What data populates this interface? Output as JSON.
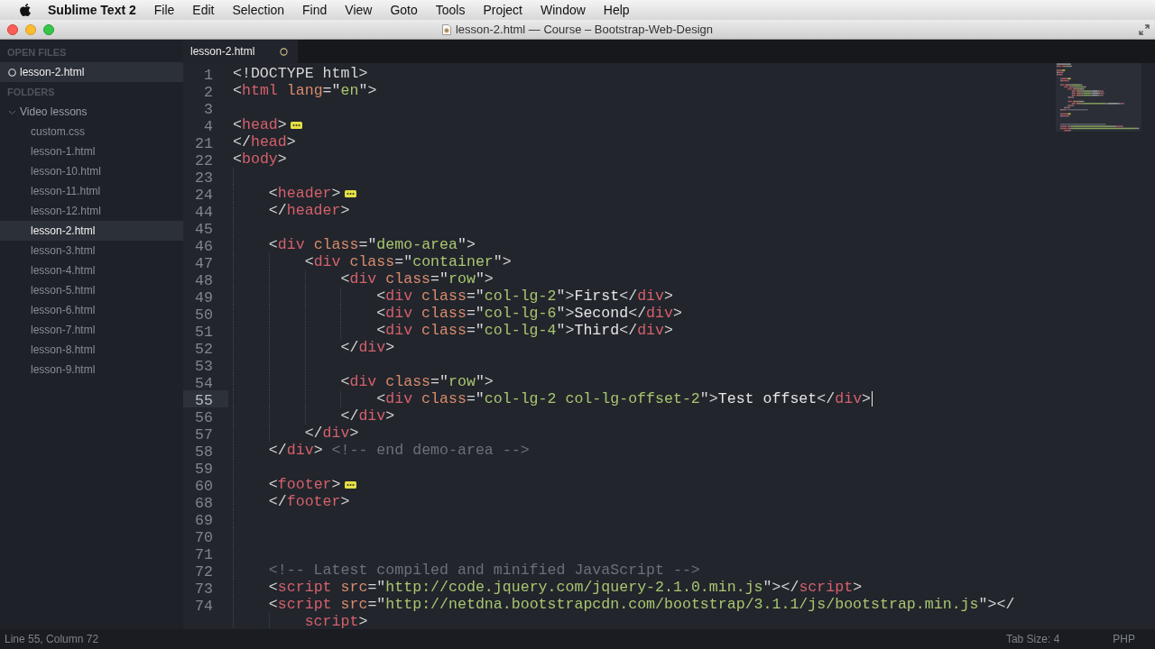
{
  "menu_bar": {
    "app_name": "Sublime Text 2",
    "items": [
      "File",
      "Edit",
      "Selection",
      "Find",
      "View",
      "Goto",
      "Tools",
      "Project",
      "Window",
      "Help"
    ]
  },
  "window": {
    "title": "lesson-2.html — Course – Bootstrap-Web-Design"
  },
  "sidebar": {
    "open_files_heading": "OPEN FILES",
    "open_files": [
      {
        "name": "lesson-2.html",
        "selected": true,
        "modified": true
      }
    ],
    "folders_heading": "FOLDERS",
    "folders": [
      {
        "name": "Video lessons",
        "expanded": true,
        "children": [
          {
            "name": "custom.css",
            "selected": false
          },
          {
            "name": "lesson-1.html",
            "selected": false
          },
          {
            "name": "lesson-10.html",
            "selected": false
          },
          {
            "name": "lesson-11.html",
            "selected": false
          },
          {
            "name": "lesson-12.html",
            "selected": false
          },
          {
            "name": "lesson-2.html",
            "selected": true
          },
          {
            "name": "lesson-3.html",
            "selected": false
          },
          {
            "name": "lesson-4.html",
            "selected": false
          },
          {
            "name": "lesson-5.html",
            "selected": false
          },
          {
            "name": "lesson-6.html",
            "selected": false
          },
          {
            "name": "lesson-7.html",
            "selected": false
          },
          {
            "name": "lesson-8.html",
            "selected": false
          },
          {
            "name": "lesson-9.html",
            "selected": false
          }
        ]
      }
    ]
  },
  "tabs": [
    {
      "label": "lesson-2.html",
      "selected": true,
      "modified": true
    }
  ],
  "editor": {
    "lines": [
      {
        "number": "1",
        "current": false,
        "tokens": [
          {
            "kind": "punct",
            "text": "<!DOCTYPE html>"
          }
        ]
      },
      {
        "number": "2",
        "current": false,
        "tokens": [
          {
            "kind": "punct",
            "text": "<"
          },
          {
            "kind": "tag",
            "text": "html"
          },
          {
            "kind": "attr",
            "text": " lang"
          },
          {
            "kind": "punct",
            "text": "=\""
          },
          {
            "kind": "string",
            "text": "en"
          },
          {
            "kind": "punct",
            "text": "\">"
          }
        ]
      },
      {
        "number": "3",
        "current": false
      },
      {
        "number": "4",
        "current": false,
        "tokens": [
          {
            "kind": "punct",
            "text": "<"
          },
          {
            "kind": "tag",
            "text": "head"
          },
          {
            "kind": "punct",
            "text": ">"
          },
          {
            "kind": "fold"
          }
        ]
      },
      {
        "number": "21",
        "current": false,
        "tokens": [
          {
            "kind": "punct",
            "text": "</"
          },
          {
            "kind": "tag",
            "text": "head"
          },
          {
            "kind": "punct",
            "text": ">"
          }
        ]
      },
      {
        "number": "22",
        "current": false,
        "tokens": [
          {
            "kind": "punct",
            "text": "<"
          },
          {
            "kind": "tag",
            "text": "body"
          },
          {
            "kind": "punct",
            "text": ">"
          }
        ]
      },
      {
        "number": "23",
        "current": false
      },
      {
        "number": "24",
        "current": false,
        "tokens": [
          {
            "kind": "punct",
            "text": "    <"
          },
          {
            "kind": "tag",
            "text": "header"
          },
          {
            "kind": "punct",
            "text": ">"
          },
          {
            "kind": "fold"
          }
        ]
      },
      {
        "number": "44",
        "current": false,
        "tokens": [
          {
            "kind": "punct",
            "text": "    </"
          },
          {
            "kind": "tag",
            "text": "header"
          },
          {
            "kind": "punct",
            "text": ">"
          }
        ]
      },
      {
        "number": "45",
        "current": false
      },
      {
        "number": "46",
        "current": false,
        "tokens": [
          {
            "kind": "punct",
            "text": "    <"
          },
          {
            "kind": "tag",
            "text": "div"
          },
          {
            "kind": "attr",
            "text": " class"
          },
          {
            "kind": "punct",
            "text": "=\""
          },
          {
            "kind": "string",
            "text": "demo-area"
          },
          {
            "kind": "punct",
            "text": "\">"
          }
        ]
      },
      {
        "number": "47",
        "current": false,
        "tokens": [
          {
            "kind": "punct",
            "text": "        <"
          },
          {
            "kind": "tag",
            "text": "div"
          },
          {
            "kind": "attr",
            "text": " class"
          },
          {
            "kind": "punct",
            "text": "=\""
          },
          {
            "kind": "string",
            "text": "container"
          },
          {
            "kind": "punct",
            "text": "\">"
          }
        ]
      },
      {
        "number": "48",
        "current": false,
        "tokens": [
          {
            "kind": "punct",
            "text": "            <"
          },
          {
            "kind": "tag",
            "text": "div"
          },
          {
            "kind": "attr",
            "text": " class"
          },
          {
            "kind": "punct",
            "text": "=\""
          },
          {
            "kind": "string",
            "text": "row"
          },
          {
            "kind": "punct",
            "text": "\">"
          }
        ]
      },
      {
        "number": "49",
        "current": false,
        "tokens": [
          {
            "kind": "punct",
            "text": "                <"
          },
          {
            "kind": "tag",
            "text": "div"
          },
          {
            "kind": "attr",
            "text": " class"
          },
          {
            "kind": "punct",
            "text": "=\""
          },
          {
            "kind": "string",
            "text": "col-lg-2"
          },
          {
            "kind": "punct",
            "text": "\">"
          },
          {
            "kind": "text",
            "text": "First"
          },
          {
            "kind": "punct",
            "text": "</"
          },
          {
            "kind": "tag",
            "text": "div"
          },
          {
            "kind": "punct",
            "text": ">"
          }
        ]
      },
      {
        "number": "50",
        "current": false,
        "tokens": [
          {
            "kind": "punct",
            "text": "                <"
          },
          {
            "kind": "tag",
            "text": "div"
          },
          {
            "kind": "attr",
            "text": " class"
          },
          {
            "kind": "punct",
            "text": "=\""
          },
          {
            "kind": "string",
            "text": "col-lg-6"
          },
          {
            "kind": "punct",
            "text": "\">"
          },
          {
            "kind": "text",
            "text": "Second"
          },
          {
            "kind": "punct",
            "text": "</"
          },
          {
            "kind": "tag",
            "text": "div"
          },
          {
            "kind": "punct",
            "text": ">"
          }
        ]
      },
      {
        "number": "51",
        "current": false,
        "tokens": [
          {
            "kind": "punct",
            "text": "                <"
          },
          {
            "kind": "tag",
            "text": "div"
          },
          {
            "kind": "attr",
            "text": " class"
          },
          {
            "kind": "punct",
            "text": "=\""
          },
          {
            "kind": "string",
            "text": "col-lg-4"
          },
          {
            "kind": "punct",
            "text": "\">"
          },
          {
            "kind": "text",
            "text": "Third"
          },
          {
            "kind": "punct",
            "text": "</"
          },
          {
            "kind": "tag",
            "text": "div"
          },
          {
            "kind": "punct",
            "text": ">"
          }
        ]
      },
      {
        "number": "52",
        "current": false,
        "tokens": [
          {
            "kind": "punct",
            "text": "            </"
          },
          {
            "kind": "tag",
            "text": "div"
          },
          {
            "kind": "punct",
            "text": ">"
          }
        ]
      },
      {
        "number": "53",
        "current": false
      },
      {
        "number": "54",
        "current": false,
        "tokens": [
          {
            "kind": "punct",
            "text": "            <"
          },
          {
            "kind": "tag",
            "text": "div"
          },
          {
            "kind": "attr",
            "text": " class"
          },
          {
            "kind": "punct",
            "text": "=\""
          },
          {
            "kind": "string",
            "text": "row"
          },
          {
            "kind": "punct",
            "text": "\">"
          }
        ]
      },
      {
        "number": "55",
        "current": true,
        "tokens": [
          {
            "kind": "punct",
            "text": "                <"
          },
          {
            "kind": "tag",
            "text": "div"
          },
          {
            "kind": "attr",
            "text": " class"
          },
          {
            "kind": "punct",
            "text": "=\""
          },
          {
            "kind": "string",
            "text": "col-lg-2 col-lg-offset-2"
          },
          {
            "kind": "punct",
            "text": "\">"
          },
          {
            "kind": "text",
            "text": "Test offset"
          },
          {
            "kind": "punct",
            "text": "</"
          },
          {
            "kind": "tag",
            "text": "div"
          },
          {
            "kind": "punct",
            "text": ">"
          }
        ]
      },
      {
        "number": "56",
        "current": false,
        "tokens": [
          {
            "kind": "punct",
            "text": "            </"
          },
          {
            "kind": "tag",
            "text": "div"
          },
          {
            "kind": "punct",
            "text": ">"
          }
        ]
      },
      {
        "number": "57",
        "current": false,
        "tokens": [
          {
            "kind": "punct",
            "text": "        </"
          },
          {
            "kind": "tag",
            "text": "div"
          },
          {
            "kind": "punct",
            "text": ">"
          }
        ]
      },
      {
        "number": "58",
        "current": false,
        "tokens": [
          {
            "kind": "punct",
            "text": "    </"
          },
          {
            "kind": "tag",
            "text": "div"
          },
          {
            "kind": "punct",
            "text": ">"
          },
          {
            "kind": "comment",
            "text": " <!-- end demo-area -->"
          }
        ]
      },
      {
        "number": "59",
        "current": false
      },
      {
        "number": "60",
        "current": false,
        "tokens": [
          {
            "kind": "punct",
            "text": "    <"
          },
          {
            "kind": "tag",
            "text": "footer"
          },
          {
            "kind": "punct",
            "text": ">"
          },
          {
            "kind": "fold"
          }
        ]
      },
      {
        "number": "68",
        "current": false,
        "tokens": [
          {
            "kind": "punct",
            "text": "    </"
          },
          {
            "kind": "tag",
            "text": "footer"
          },
          {
            "kind": "punct",
            "text": ">"
          }
        ]
      },
      {
        "number": "69",
        "current": false
      },
      {
        "number": "70",
        "current": false
      },
      {
        "number": "71",
        "current": false
      },
      {
        "number": "72",
        "current": false,
        "tokens": [
          {
            "kind": "comment",
            "text": "    <!-- Latest compiled and minified JavaScript -->"
          }
        ]
      },
      {
        "number": "73",
        "current": false,
        "tokens": [
          {
            "kind": "punct",
            "text": "    <"
          },
          {
            "kind": "tag",
            "text": "script"
          },
          {
            "kind": "attr",
            "text": " src"
          },
          {
            "kind": "punct",
            "text": "=\""
          },
          {
            "kind": "string",
            "text": "http://code.jquery.com/jquery-2.1.0.min.js"
          },
          {
            "kind": "punct",
            "text": "\"></"
          },
          {
            "kind": "tag",
            "text": "script"
          },
          {
            "kind": "punct",
            "text": ">"
          }
        ]
      },
      {
        "number": "74",
        "current": false,
        "tokens": [
          {
            "kind": "punct",
            "text": "    <"
          },
          {
            "kind": "tag",
            "text": "script"
          },
          {
            "kind": "attr",
            "text": " src"
          },
          {
            "kind": "punct",
            "text": "=\""
          },
          {
            "kind": "string",
            "text": "http://netdna.bootstrapcdn.com/bootstrap/3.1.1/js/bootstrap.min.js"
          },
          {
            "kind": "punct",
            "text": "\"></"
          }
        ],
        "wrapped": [
          {
            "kind": "tag",
            "text": "        script"
          },
          {
            "kind": "punct",
            "text": ">"
          }
        ]
      }
    ]
  },
  "status_bar": {
    "position": "Line 55, Column 72",
    "tab_size": "Tab Size: 4",
    "syntax": "PHP"
  }
}
